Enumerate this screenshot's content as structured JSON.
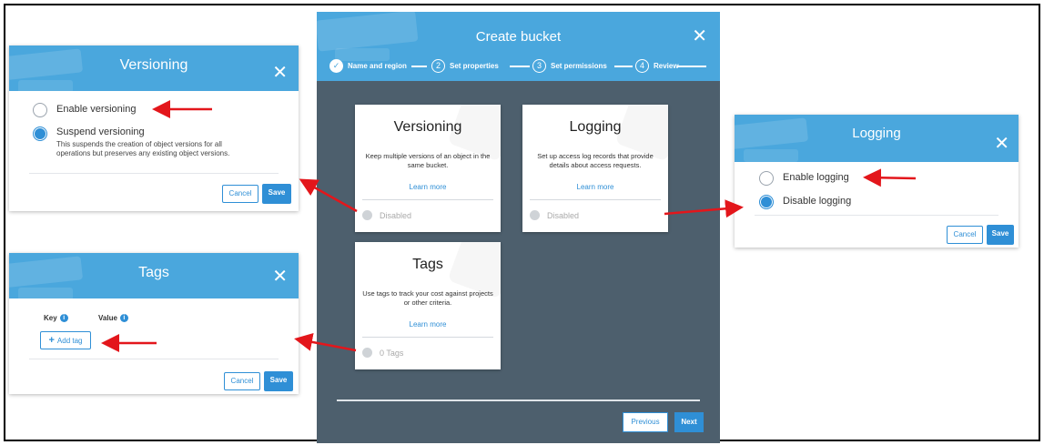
{
  "wizard": {
    "title": "Create bucket",
    "steps": [
      {
        "num": "✓",
        "label": "Name and region"
      },
      {
        "num": "2",
        "label": "Set properties"
      },
      {
        "num": "3",
        "label": "Set permissions"
      },
      {
        "num": "4",
        "label": "Review"
      }
    ],
    "cards": {
      "versioning": {
        "title": "Versioning",
        "desc": "Keep multiple versions of an object in the same bucket.",
        "link": "Learn more",
        "status": "Disabled"
      },
      "logging": {
        "title": "Logging",
        "desc": "Set up access log records that provide details about access requests.",
        "link": "Learn more",
        "status": "Disabled"
      },
      "tags": {
        "title": "Tags",
        "desc": "Use tags to track your cost against projects or other criteria.",
        "link": "Learn more",
        "status": "0 Tags"
      }
    },
    "previous_label": "Previous",
    "next_label": "Next"
  },
  "versioning_dialog": {
    "title": "Versioning",
    "option_enable": "Enable versioning",
    "option_suspend": "Suspend versioning",
    "suspend_desc": "This suspends the creation of object versions for all operations but preserves any existing object versions.",
    "cancel": "Cancel",
    "save": "Save"
  },
  "tags_dialog": {
    "title": "Tags",
    "key_label": "Key",
    "value_label": "Value",
    "add_tag": "Add tag",
    "cancel": "Cancel",
    "save": "Save"
  },
  "logging_dialog": {
    "title": "Logging",
    "option_enable": "Enable logging",
    "option_disable": "Disable logging",
    "cancel": "Cancel",
    "save": "Save"
  },
  "colors": {
    "header": "#4aa7dd",
    "accent": "#2f8fd6",
    "wizard_bg": "#4d5f6d",
    "arrow": "#e3161b"
  }
}
